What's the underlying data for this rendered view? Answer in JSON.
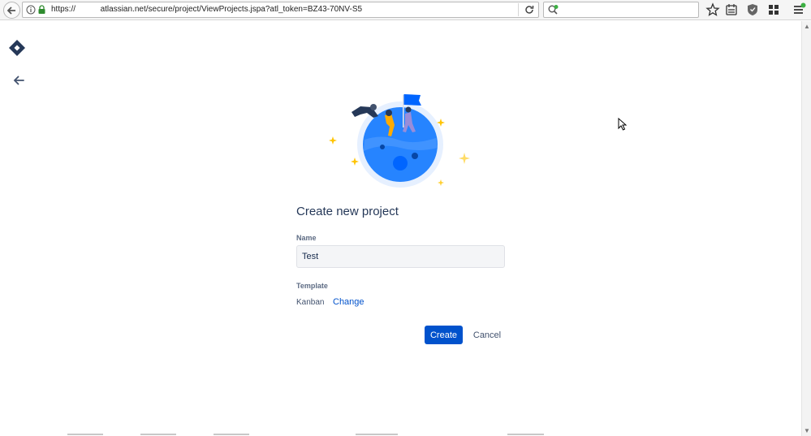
{
  "browser": {
    "url_scheme": "https://",
    "url_path": "atlassian.net/secure/project/ViewProjects.jspa?atl_token=BZ43-70NV-S5",
    "search_placeholder": ""
  },
  "form": {
    "title": "Create new project",
    "name_label": "Name",
    "name_value": "Test",
    "template_label": "Template",
    "template_value": "Kanban",
    "change_link": "Change",
    "create_button": "Create",
    "cancel_button": "Cancel"
  },
  "colors": {
    "primary": "#0052cc",
    "heading": "#253858",
    "muted": "#5e6c84"
  },
  "icons": [
    "back-icon",
    "info-icon",
    "lock-icon",
    "reload-icon",
    "search-icon",
    "star-icon",
    "reading-list-icon",
    "shield-icon",
    "extensions-icon",
    "menu-icon",
    "jira-logo-icon",
    "arrow-left-icon"
  ]
}
